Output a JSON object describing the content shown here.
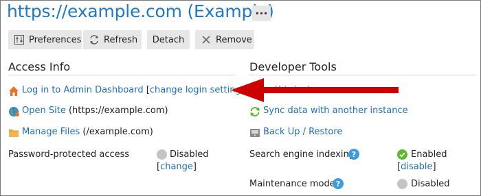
{
  "header": {
    "title": "https://example.com (Example)",
    "more_label": "···"
  },
  "toolbar": {
    "preferences": "Preferences",
    "refresh": "Refresh",
    "detach": "Detach",
    "remove": "Remove"
  },
  "access_info": {
    "title": "Access Info",
    "login_link": "Log in to Admin Dashboard",
    "login_settings_link": "change login settings",
    "open_site_link": "Open Site",
    "open_site_url": "https://example.com",
    "manage_files_link": "Manage Files",
    "manage_files_path": "/example.com",
    "password_label": "Password-protected access",
    "password_status": "Disabled",
    "password_change_link": "change"
  },
  "developer_tools": {
    "title": "Developer Tools",
    "hidden_item_text": "… this instance",
    "sync_link": "Sync data with another instance",
    "backup_link": "Back Up / Restore",
    "indexing_label": "Search engine indexing",
    "indexing_status": "Enabled",
    "indexing_toggle_link": "disable",
    "maintenance_label": "Maintenance mode",
    "maintenance_status": "Disabled"
  },
  "colors": {
    "link": "#1f6fb2",
    "title": "#1f78c8",
    "arrow": "#cc0000",
    "enabled": "#5cb82f",
    "disabled": "#c4c4c4",
    "help": "#3d9be0"
  }
}
